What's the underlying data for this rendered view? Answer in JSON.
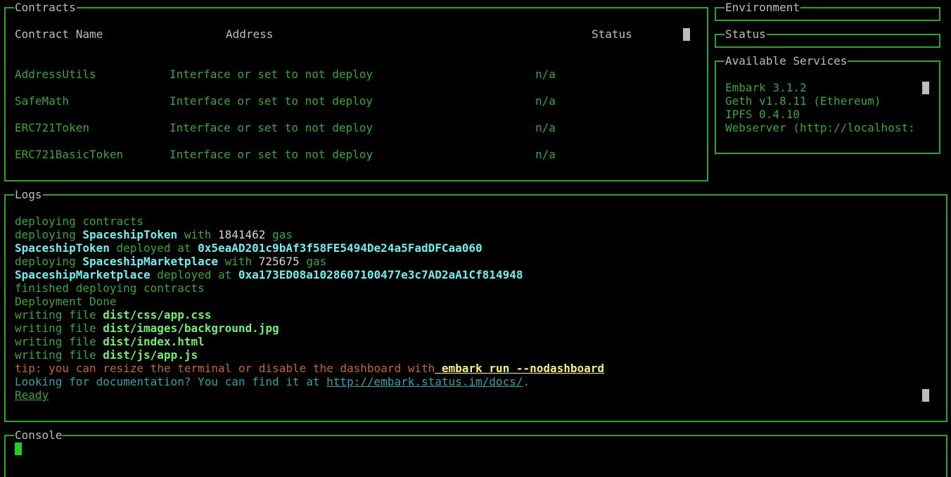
{
  "contracts": {
    "title": "Contracts",
    "headers": {
      "name": "Contract Name",
      "address": "Address",
      "status": "Status"
    },
    "rows": [
      {
        "name": "AddressUtils",
        "address": "Interface or set to not deploy",
        "status": "n/a"
      },
      {
        "name": "SafeMath",
        "address": "Interface or set to not deploy",
        "status": "n/a"
      },
      {
        "name": "ERC721Token",
        "address": "Interface or set to not deploy",
        "status": "n/a"
      },
      {
        "name": "ERC721BasicToken",
        "address": "Interface or set to not deploy",
        "status": "n/a"
      }
    ]
  },
  "environment": {
    "title": "Environment"
  },
  "status": {
    "title": "Status"
  },
  "services": {
    "title": "Available Services",
    "items": [
      "Embark 3.1.2",
      "Geth v1.8.11 (Ethereum)",
      "IPFS 0.4.10",
      "Webserver (http://localhost:"
    ]
  },
  "logs": {
    "title": "Logs",
    "lines": [
      {
        "segments": [
          {
            "text": "deploying contracts",
            "style": "green"
          }
        ]
      },
      {
        "segments": [
          {
            "text": "deploying ",
            "style": "green"
          },
          {
            "text": "SpaceshipToken",
            "style": "cyan-b"
          },
          {
            "text": " with ",
            "style": "green"
          },
          {
            "text": "1841462",
            "style": "white"
          },
          {
            "text": " gas",
            "style": "green"
          }
        ]
      },
      {
        "segments": [
          {
            "text": "SpaceshipToken",
            "style": "cyan-b"
          },
          {
            "text": " deployed at ",
            "style": "green"
          },
          {
            "text": "0x5eaAD201c9bAf3f58FE5494De24a5FadDFCaa060",
            "style": "cyan-b"
          }
        ]
      },
      {
        "segments": [
          {
            "text": "deploying ",
            "style": "green"
          },
          {
            "text": "SpaceshipMarketplace",
            "style": "cyan-b"
          },
          {
            "text": " with ",
            "style": "green"
          },
          {
            "text": "725675",
            "style": "white"
          },
          {
            "text": " gas",
            "style": "green"
          }
        ]
      },
      {
        "segments": [
          {
            "text": "SpaceshipMarketplace",
            "style": "cyan-b"
          },
          {
            "text": " deployed at ",
            "style": "green"
          },
          {
            "text": "0xa173ED08a1028607100477e3c7AD2aA1Cf814948",
            "style": "cyan-b"
          }
        ]
      },
      {
        "segments": [
          {
            "text": "finished deploying contracts",
            "style": "green"
          }
        ]
      },
      {
        "segments": [
          {
            "text": "Deployment Done",
            "style": "green"
          }
        ]
      },
      {
        "segments": [
          {
            "text": "writing file ",
            "style": "green"
          },
          {
            "text": "dist/css/app.css",
            "style": "bright-green"
          }
        ]
      },
      {
        "segments": [
          {
            "text": "writing file ",
            "style": "green"
          },
          {
            "text": "dist/images/background.jpg",
            "style": "bright-green"
          }
        ]
      },
      {
        "segments": [
          {
            "text": "writing file ",
            "style": "green"
          },
          {
            "text": "dist/index.html",
            "style": "bright-green"
          }
        ]
      },
      {
        "segments": [
          {
            "text": "writing file ",
            "style": "green"
          },
          {
            "text": "dist/js/app.js",
            "style": "bright-green"
          }
        ]
      },
      {
        "segments": [
          {
            "text": "tip: you can resize the terminal or disable the dashboard with",
            "style": "orange"
          },
          {
            "text": " embark run --nodashboard",
            "style": "yellow-u"
          }
        ]
      },
      {
        "segments": [
          {
            "text": "Looking for documentation? You can find it at ",
            "style": "teal"
          },
          {
            "text": "http://embark.status.im/docs/",
            "style": "teal-u"
          },
          {
            "text": ".",
            "style": "teal"
          }
        ]
      },
      {
        "segments": [
          {
            "text": "Ready",
            "style": "green-u"
          }
        ]
      }
    ]
  },
  "console": {
    "title": "Console",
    "input_value": ""
  }
}
